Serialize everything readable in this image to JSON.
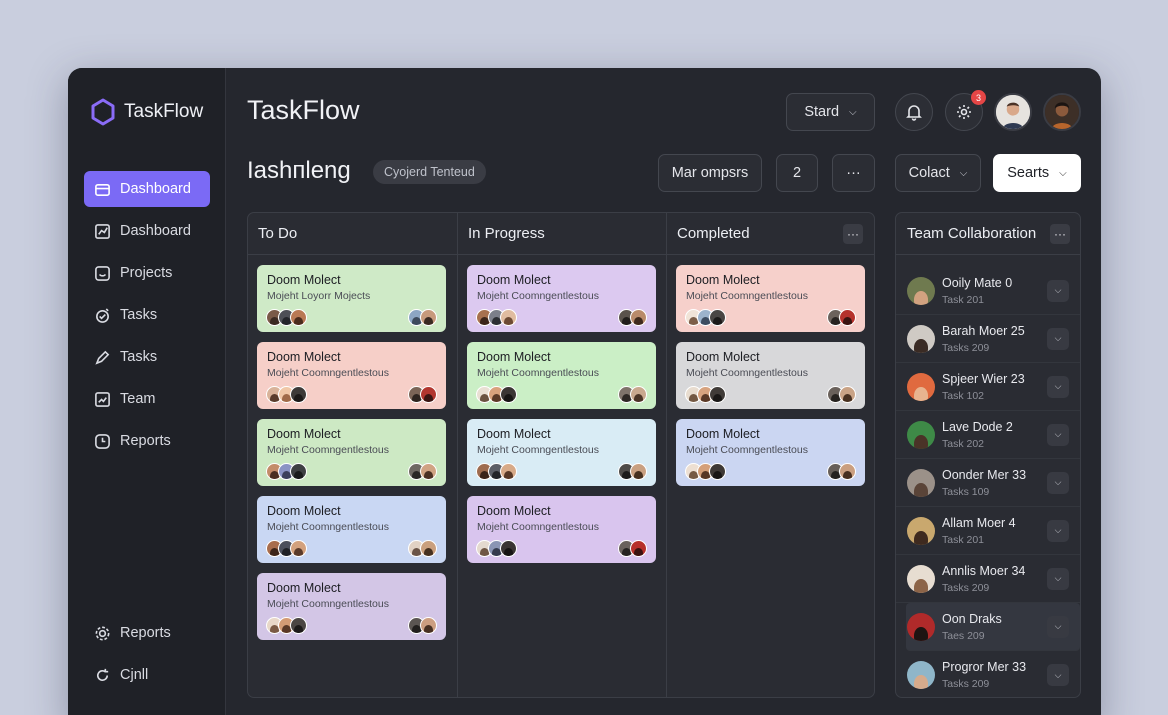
{
  "app": {
    "name": "TaskFlow",
    "title": "TaskFlow"
  },
  "sidebar": {
    "items": [
      {
        "label": "Dashboard",
        "icon": "dashboard-icon",
        "active": true
      },
      {
        "label": "Dashboard",
        "icon": "chart-icon"
      },
      {
        "label": "Projects",
        "icon": "projects-icon"
      },
      {
        "label": "Tasks",
        "icon": "tasks-icon"
      },
      {
        "label": "Tasks",
        "icon": "pen-icon"
      },
      {
        "label": "Team",
        "icon": "team-chart-icon"
      },
      {
        "label": "Reports",
        "icon": "clock-icon"
      }
    ],
    "bottom_items": [
      {
        "label": "Reports",
        "icon": "gear-icon"
      },
      {
        "label": "Cjnll",
        "icon": "refresh-icon"
      }
    ]
  },
  "header": {
    "stard_label": "Stard",
    "notification_badge": "3",
    "subtitle": "Iashпleng",
    "subtitle_tag": "Cyojerd Tenteud",
    "filter_label": "Mar ompsrs",
    "count_label": "2",
    "more_label": "···",
    "colact_label": "Colact",
    "searts_label": "Searts"
  },
  "board": {
    "columns": [
      {
        "title": "To Do",
        "cards": [
          {
            "title": "Doom Molect",
            "subtitle": "Mojeht Loyorr Mojects",
            "color": "#cfeac7"
          },
          {
            "title": "Doom Molect",
            "subtitle": "Mojeht Coomngentlestous",
            "color": "#f6cfc8"
          },
          {
            "title": "Doom Molect",
            "subtitle": "Mojeht Coomngentlestous",
            "color": "#cde9c4"
          },
          {
            "title": "Doom Molect",
            "subtitle": "Mojeht Coomngentlestous",
            "color": "#c9d7f3"
          },
          {
            "title": "Doom Molect",
            "subtitle": "Mojeht Coomngentlestous",
            "color": "#d3c6e6"
          }
        ]
      },
      {
        "title": "In Progress",
        "cards": [
          {
            "title": "Doom Molect",
            "subtitle": "Mojeht Coomngentlestous",
            "color": "#dcc9f0"
          },
          {
            "title": "Doom Molect",
            "subtitle": "Mojeht Coomngentlestous",
            "color": "#cbefc6"
          },
          {
            "title": "Doom Molect",
            "subtitle": "Mojeht Coomngentlestous",
            "color": "#d9ecf5"
          },
          {
            "title": "Doom Molect",
            "subtitle": "Mojeht Coomngentlestous",
            "color": "#d9c5ee"
          }
        ]
      },
      {
        "title": "Completed",
        "cards": [
          {
            "title": "Doom Molect",
            "subtitle": "Mojeht Coomngentlestous",
            "color": "#f6d0cb"
          },
          {
            "title": "Doom Molect",
            "subtitle": "Mojeht Coomngentlestous",
            "color": "#d8d8da"
          },
          {
            "title": "Doom Molect",
            "subtitle": "Mojeht Coomngentlestous",
            "color": "#cbd6f2"
          }
        ]
      }
    ],
    "column_more_label": "···"
  },
  "team": {
    "title": "Team Collaboration",
    "more_label": "···",
    "members": [
      {
        "name": "Ooily Mate 0",
        "sub": "Task 201"
      },
      {
        "name": "Barah Moer 25",
        "sub": "Tasks 209"
      },
      {
        "name": "Spjeer Wier 23",
        "sub": "Task 102"
      },
      {
        "name": "Lave Dode 2",
        "sub": "Task 202"
      },
      {
        "name": "Oonder Mer 33",
        "sub": "Tasks 109"
      },
      {
        "name": "Allam Moer 4",
        "sub": "Task 201"
      },
      {
        "name": "Annlis Moer 34",
        "sub": "Tasks 209"
      },
      {
        "name": "Oon Draks",
        "sub": "Taеs 209"
      },
      {
        "name": "Progror Mer 33",
        "sub": "Tasks 209"
      }
    ]
  },
  "colors": {
    "accent": "#7b6af5",
    "background": "#25272e",
    "sidebar": "#1f2127",
    "badge": "#e54646"
  }
}
